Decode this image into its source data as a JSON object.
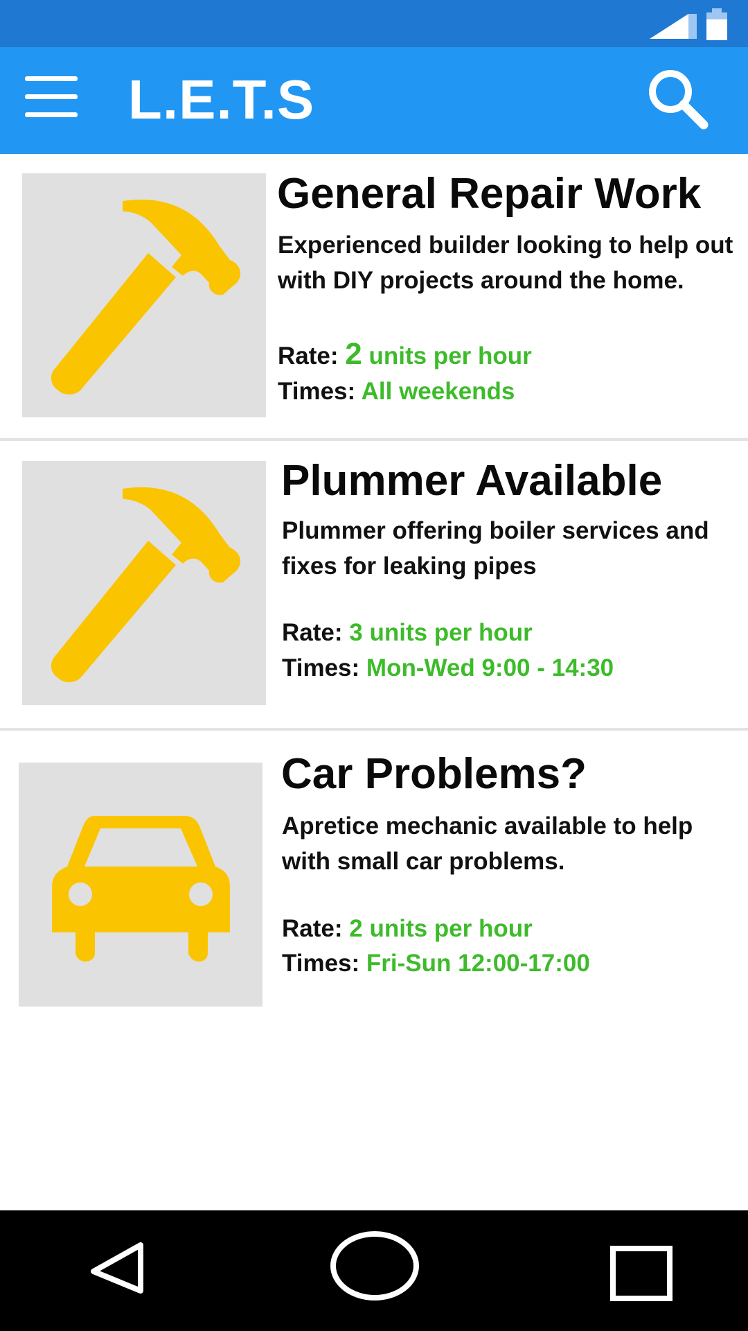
{
  "app": {
    "title": "L.E.T.S",
    "accent_color": "#2196f3",
    "status_bar_color": "#1f78d1"
  },
  "listings": [
    {
      "title": "General Repair Work",
      "description": "Experienced builder looking to help out with DIY projects around the home.",
      "rate_label": "Rate:",
      "rate_number": "2",
      "rate_unit": "units per hour",
      "times_label": "Times:",
      "times_value": "All weekends",
      "icon": "hammer-icon"
    },
    {
      "title": "Plummer Available",
      "description": "Plummer offering boiler services and fixes for leaking pipes",
      "rate_label": "Rate:",
      "rate_value": "3 units per hour",
      "times_label": "Times:",
      "times_value": "Mon-Wed 9:00 - 14:30",
      "icon": "hammer-icon"
    },
    {
      "title": "Car Problems?",
      "description": "Apretice mechanic available to help with small car problems.",
      "rate_label": "Rate:",
      "rate_value": "2 units per hour",
      "times_label": "Times:",
      "times_value": "Fri-Sun 12:00-17:00",
      "icon": "car-icon"
    }
  ],
  "nav": {
    "back_icon": "back-triangle-icon",
    "home_icon": "home-circle-icon",
    "recents_icon": "recents-square-icon"
  }
}
